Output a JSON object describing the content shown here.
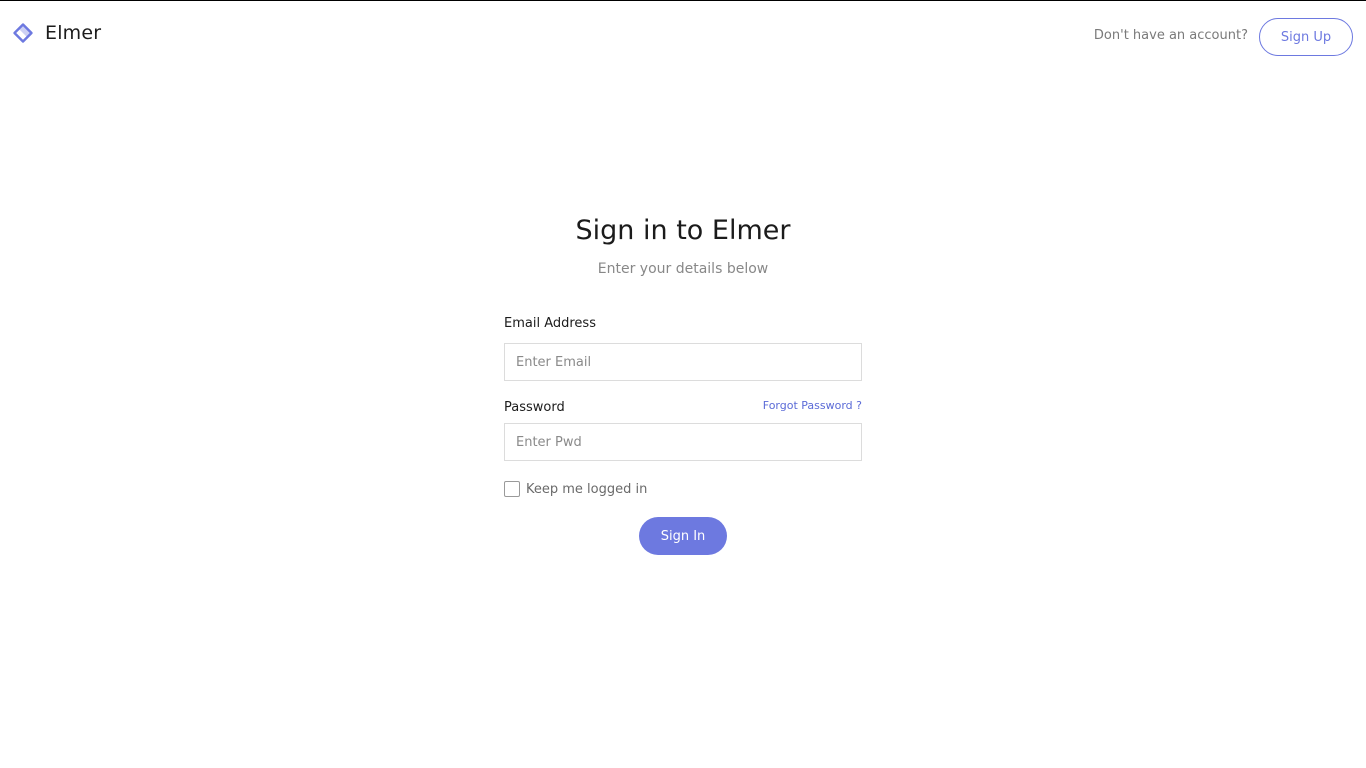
{
  "brand": {
    "name": "Elmer",
    "icon": "diamond-logo-icon",
    "accent_color": "#6d79e0"
  },
  "header": {
    "account_prompt": "Don't have an account?",
    "signup_label": "Sign Up"
  },
  "form": {
    "title": "Sign in to Elmer",
    "subtitle": "Enter your details below",
    "email_label": "Email Address",
    "email_placeholder": "Enter Email",
    "email_value": "",
    "password_label": "Password",
    "forgot_label": "Forgot Password ?",
    "password_placeholder": "Enter Pwd",
    "password_value": "",
    "remember_label": "Keep me logged in",
    "remember_checked": false,
    "submit_label": "Sign In"
  }
}
